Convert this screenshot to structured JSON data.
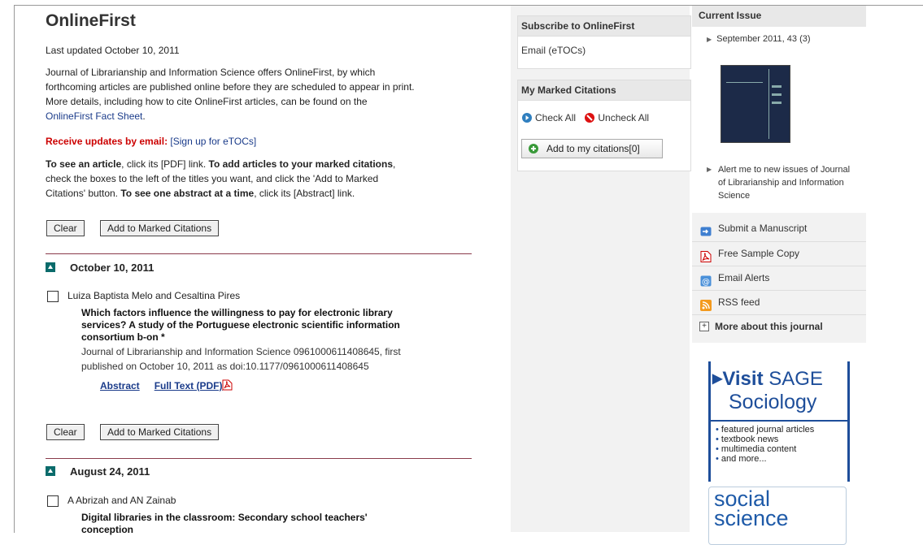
{
  "main": {
    "title": "OnlineFirst",
    "last_updated": "Last updated October 10, 2011",
    "intro_lines": [
      "Journal of Librarianship and Information Science offers OnlineFirst, by which",
      "forthcoming articles are published online before they are scheduled to appear in print.",
      "More details, including how to cite OnlineFirst articles, can be found on the"
    ],
    "fact_sheet_link": "OnlineFirst Fact Sheet",
    "fact_sheet_end": ".",
    "receive_updates_label": "Receive updates by email:",
    "signup_link": "[Sign up for eTOCs]",
    "instructions": {
      "see_article_bold": "To see an article",
      "see_article_rest": ", click its [PDF] link. ",
      "add_bold": "To add articles to your marked citations",
      "add_rest": ",",
      "line2": "check the boxes to the left of the titles you want, and click the 'Add to Marked",
      "line3_start": "Citations' button. ",
      "one_abstract_bold": "To see one abstract at a time",
      "line3_end": ", click its [Abstract] link."
    },
    "clear_label": "Clear",
    "add_marked_label": "Add to Marked Citations",
    "sections": [
      {
        "date": "October 10, 2011",
        "authors": "Luiza Baptista Melo and Cesaltina Pires",
        "title_lines": [
          "Which factors influence the willingness to pay for electronic library",
          "services? A study of the Portuguese electronic scientific information",
          "consortium b-on *"
        ],
        "meta_lines": [
          "Journal of Librarianship and Information Science 0961000611408645, first",
          "published on October 10, 2011 as doi:10.1177/0961000611408645"
        ],
        "abstract_link": "Abstract",
        "fulltext_link": "Full Text (PDF)"
      },
      {
        "date": "August 24, 2011",
        "authors": "A Abrizah and AN Zainab",
        "title_lines": [
          "Digital libraries in the classroom: Secondary school teachers'",
          "conception"
        ]
      }
    ]
  },
  "middle": {
    "subscribe_header": "Subscribe to OnlineFirst",
    "email_etocs": "Email (eTOCs)",
    "marked_header": "My Marked Citations",
    "check_all": "Check All",
    "uncheck_all": "Uncheck All",
    "add_citations": "Add to my citations[0]"
  },
  "right": {
    "current_issue_header": "Current Issue",
    "issue_link": "September 2011, 43 (3)",
    "alert_lines": [
      "Alert me to new issues of Journal",
      "of Librarianship and Information",
      "Science"
    ],
    "links": [
      {
        "label": "Submit a Manuscript",
        "icon": "submit-manuscript-icon"
      },
      {
        "label": "Free Sample Copy",
        "icon": "pdf-icon"
      },
      {
        "label": "Email Alerts",
        "icon": "email-alerts-icon"
      },
      {
        "label": "RSS feed",
        "icon": "rss-icon"
      }
    ],
    "more_about": "More about this journal",
    "ad_sage": {
      "visit": "Visit",
      "sage": "SAGE",
      "sociology": "Sociology",
      "bullets": [
        "featured journal articles",
        "textbook news",
        "multimedia content",
        "and more..."
      ]
    },
    "ad_social": {
      "line1": "social",
      "line2": "science"
    }
  },
  "colors": {
    "link": "#1a3b8a",
    "alert_red": "#cc0000",
    "section_rule": "#8a3a4a",
    "section_toggle": "#0a6b6b",
    "sage_blue": "#1e4e9a"
  }
}
